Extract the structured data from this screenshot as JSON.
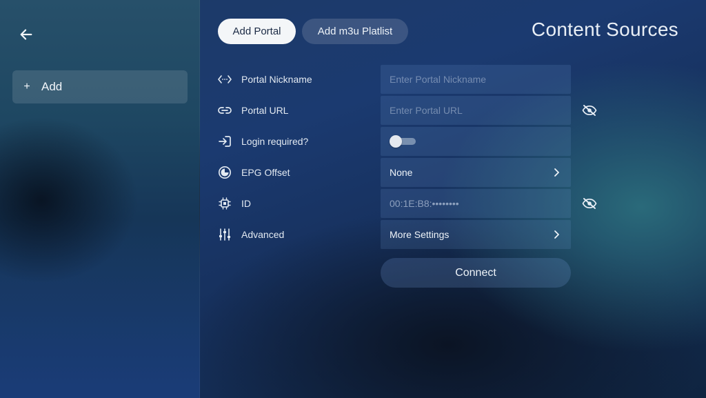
{
  "header": {
    "title": "Content Sources",
    "tabs": [
      {
        "label": "Add Portal",
        "active": true
      },
      {
        "label": "Add m3u Platlist",
        "active": false
      }
    ]
  },
  "sidebar": {
    "back_icon": "arrow-left-icon",
    "items": [
      {
        "icon": "plus-icon",
        "icon_glyph": "+",
        "label": "Add"
      }
    ]
  },
  "form": {
    "rows": [
      {
        "label": "Portal Nickname",
        "icon": "code-brackets-icon",
        "type": "input",
        "placeholder": "Enter Portal Nickname",
        "value": ""
      },
      {
        "label": "Portal URL",
        "icon": "link-icon",
        "type": "input",
        "placeholder": "Enter Portal URL",
        "value": "",
        "eye_icon": "eye-slash-icon"
      },
      {
        "label": "Login required?",
        "icon": "login-icon",
        "type": "toggle",
        "toggle_on": false
      },
      {
        "label": "EPG Offset",
        "icon": "clock-icon",
        "type": "select",
        "value": "None"
      },
      {
        "label": "ID",
        "icon": "chip-icon",
        "type": "masked",
        "value": "00:1E:B8:••••••••",
        "eye_icon": "eye-slash-icon"
      },
      {
        "label": "Advanced",
        "icon": "sliders-icon",
        "type": "select",
        "value": "More Settings"
      }
    ],
    "connect_label": "Connect"
  },
  "colors": {
    "active_tab_bg": "#f4f6f8",
    "active_tab_text": "#1b2a44",
    "field_bg": "#2e4a7a",
    "text": "#e6eef7"
  }
}
